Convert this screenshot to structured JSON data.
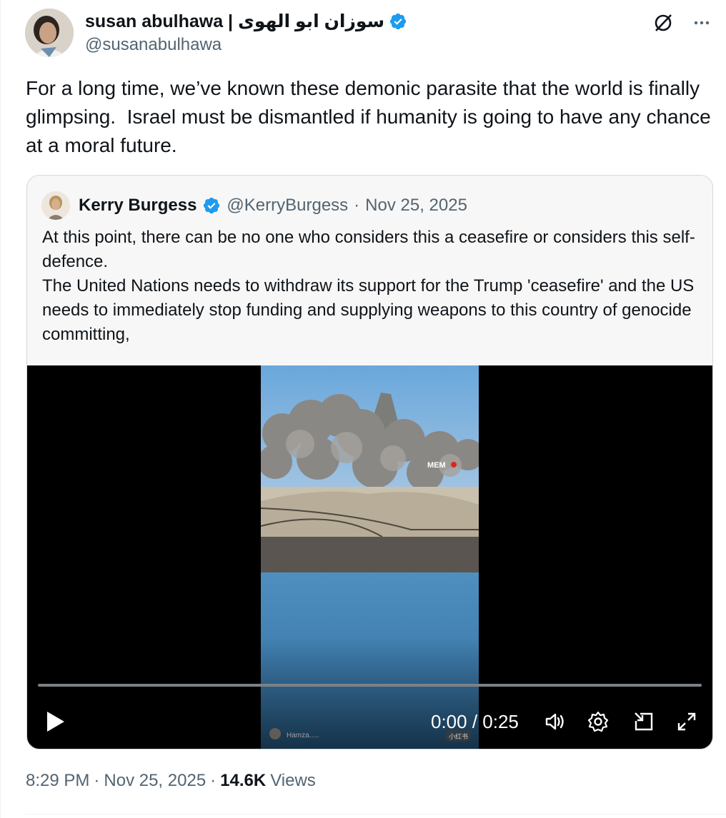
{
  "author": {
    "display_name": "susan abulhawa | سوزان ابو الهوى",
    "handle": "@susanabulhawa"
  },
  "tweet": {
    "text": "For a long time, we’ve known these demonic parasite that the world is finally glimpsing.  Israel must be dismantled if humanity is going to have any chance at a moral future."
  },
  "quote": {
    "display_name": "Kerry Burgess",
    "handle": "@KerryBurgess",
    "separator": "·",
    "date": "Nov 25, 2025",
    "text": "At this point, there can be no one who considers this a ceasefire or considers this self-defence.\nThe United Nations needs to withdraw its support for the Trump 'ceasefire' and the US needs to immediately stop funding and supplying weapons to this country of genocide committing,",
    "video": {
      "current_time": "0:00",
      "time_separator": " / ",
      "duration": "0:25",
      "progress": 0,
      "watermark": "MEM",
      "frame_caption": "Hamza.....",
      "frame_badge": "小红书"
    }
  },
  "footer": {
    "time": "8:29 PM",
    "sep1": "·",
    "date": "Nov 25, 2025",
    "sep2": "·",
    "views_count": "14.6K",
    "views_label": "Views"
  },
  "colors": {
    "verified": "#1d9bf0",
    "secondary_text": "#536471",
    "border": "#cfd9de"
  },
  "icons": [
    "verified-badge-icon",
    "grok-icon",
    "more-icon",
    "play-icon",
    "volume-icon",
    "settings-icon",
    "pip-icon",
    "fullscreen-icon"
  ]
}
